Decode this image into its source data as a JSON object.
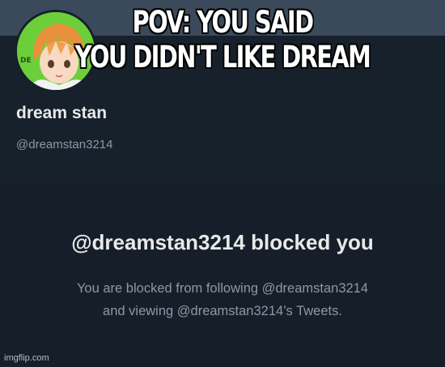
{
  "meme": {
    "caption_line1": "POV: YOU SAID",
    "caption_line2": "YOU DIDN'T LIKE DREAM",
    "watermark": "imgflip.com"
  },
  "profile": {
    "display_name": "dream stan",
    "handle": "@dreamstan3214",
    "avatar_icon": "anime-character-avatar"
  },
  "blocked_notice": {
    "title": "@dreamstan3214 blocked you",
    "line1": "You are blocked from following @dreamstan3214",
    "line2": "and viewing @dreamstan3214’s Tweets."
  },
  "colors": {
    "background": "#15202b",
    "primary_text": "#e7e9ea",
    "secondary_text": "#8b98a5",
    "avatar_bg": "#6ccf3a"
  }
}
